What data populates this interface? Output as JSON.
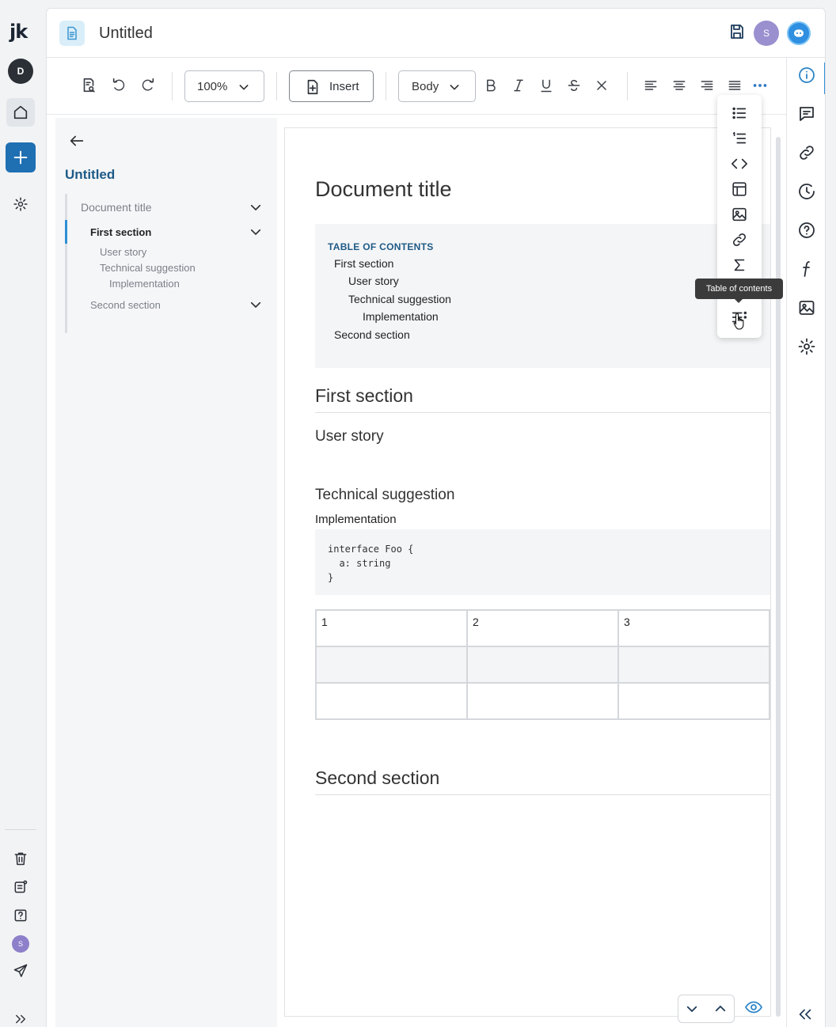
{
  "app": {
    "logo": "jk"
  },
  "left_rail": {
    "user_initial": "D",
    "footer_user_initial": "S"
  },
  "header": {
    "title": "Untitled",
    "user_initial": "S"
  },
  "toolbar": {
    "zoom": "100%",
    "insert_label": "Insert",
    "style": "Body"
  },
  "outline": {
    "title": "Untitled",
    "items": [
      {
        "label": "Document title"
      },
      {
        "label": "First section"
      },
      {
        "label": "User story"
      },
      {
        "label": "Technical suggestion"
      },
      {
        "label": "Implementation"
      },
      {
        "label": "Second section"
      }
    ]
  },
  "document": {
    "title": "Document title",
    "toc": {
      "heading": "TABLE OF CONTENTS",
      "items": [
        {
          "label": "First section"
        },
        {
          "label": "User story"
        },
        {
          "label": "Technical suggestion"
        },
        {
          "label": "Implementation"
        },
        {
          "label": "Second section"
        }
      ]
    },
    "first_section": "First section",
    "user_story": "User story",
    "technical_suggestion": "Technical suggestion",
    "implementation": "Implementation",
    "code": "interface Foo {\n  a: string\n}",
    "table": [
      [
        "1",
        "2",
        "3"
      ],
      [
        "",
        "",
        ""
      ],
      [
        "",
        "",
        ""
      ]
    ],
    "second_section": "Second section"
  },
  "overflow_menu": {
    "tooltip": "Table of contents",
    "items": [
      "bulleted-list",
      "numbered-list",
      "code-block",
      "table",
      "image",
      "link",
      "formula",
      "table-of-contents"
    ]
  },
  "colors": {
    "accent": "#2e8fd6",
    "add_button": "#1f6fb3",
    "outline_title": "#1e5a86"
  }
}
